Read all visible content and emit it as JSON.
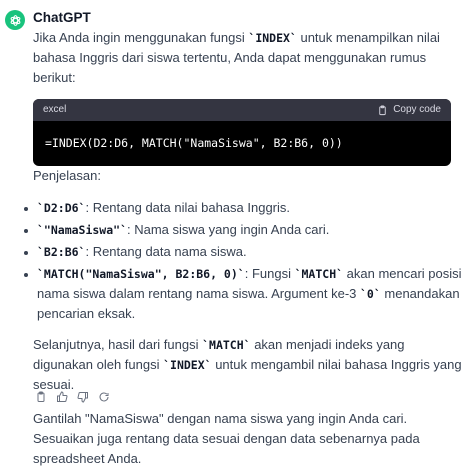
{
  "message": {
    "author": "ChatGPT",
    "intro_a": "Jika Anda ingin menggunakan fungsi ",
    "intro_code": "`INDEX`",
    "intro_b": " untuk menampilkan nilai bahasa Inggris dari siswa tertentu, Anda dapat menggunakan rumus berikut:",
    "code_block": {
      "language": "excel",
      "copy_label": "Copy code",
      "code": "=INDEX(D2:D6, MATCH(\"NamaSiswa\", B2:B6, 0))"
    },
    "explanation_title": "Penjelasan:",
    "bullets": [
      {
        "code": "`D2:D6`",
        "text": ": Rentang data nilai bahasa Inggris."
      },
      {
        "code": "`\"NamaSiswa\"`",
        "text": ": Nama siswa yang ingin Anda cari."
      },
      {
        "code": "`B2:B6`",
        "text": ": Rentang data nama siswa."
      },
      {
        "code": "`MATCH(\"NamaSiswa\", B2:B6, 0)`",
        "text_a": ": Fungsi ",
        "code2": "`MATCH`",
        "text_b": " akan mencari posisi nama siswa dalam rentang nama siswa. Argument ke-3 ",
        "code3": "`0`",
        "text_c": " menandakan pencarian eksak."
      }
    ],
    "para2_a": "Selanjutnya, hasil dari fungsi ",
    "para2_code1": "`MATCH`",
    "para2_b": " akan menjadi indeks yang digunakan oleh fungsi ",
    "para2_code2": "`INDEX`",
    "para2_c": " untuk mengambil nilai bahasa Inggris yang sesuai.",
    "para3": "Gantilah \"NamaSiswa\" dengan nama siswa yang ingin Anda cari. Sesuaikan juga rentang data sesuai dengan data sebenarnya pada spreadsheet Anda."
  },
  "icons": {
    "avatar": "openai-logo-icon",
    "copy": "clipboard-icon",
    "actions": [
      "copy-icon",
      "thumbs-up-icon",
      "thumbs-down-icon",
      "regenerate-icon"
    ]
  },
  "colors": {
    "avatar_bg": "#19c37d",
    "code_header_bg": "#343541",
    "code_body_bg": "#000000",
    "text": "#374151"
  }
}
